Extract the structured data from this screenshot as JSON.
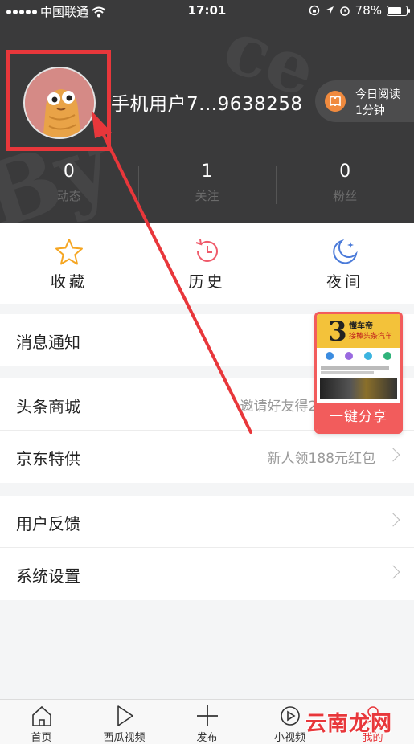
{
  "status_bar": {
    "carrier": "中国联通",
    "time": "17:01",
    "battery": "78%",
    "battery_level": 0.78
  },
  "profile": {
    "username": "手机用户7...9638258",
    "read_badge": {
      "line1": "今日阅读",
      "line2": "1分钟"
    },
    "stats": [
      {
        "value": "0",
        "label": "动态"
      },
      {
        "value": "1",
        "label": "关注"
      },
      {
        "value": "0",
        "label": "粉丝"
      }
    ]
  },
  "quick_actions": [
    {
      "label": "收藏",
      "icon": "star-icon",
      "color": "#f5a623"
    },
    {
      "label": "历史",
      "icon": "history-clock-icon",
      "color": "#ef5a6a"
    },
    {
      "label": "夜间",
      "icon": "moon-icon",
      "color": "#4a7ad9"
    }
  ],
  "menu": {
    "notifications": {
      "label": "消息通知"
    },
    "mall": {
      "label": "头条商城",
      "hint": "邀请好友得200元现金"
    },
    "jd": {
      "label": "京东特供",
      "hint": "新人领188元红包"
    },
    "feedback": {
      "label": "用户反馈"
    },
    "settings": {
      "label": "系统设置"
    }
  },
  "share_card": {
    "title": "懂车帝",
    "subtitle": "接棒头条汽车",
    "button": "一键分享"
  },
  "tabbar": [
    {
      "label": "首页",
      "icon": "home-icon"
    },
    {
      "label": "西瓜视频",
      "icon": "play-icon"
    },
    {
      "label": "发布",
      "icon": "plus-icon"
    },
    {
      "label": "小视频",
      "icon": "small-video-icon"
    },
    {
      "label": "我的",
      "icon": "user-icon",
      "active": true
    }
  ],
  "watermark": "云南龙网",
  "colors": {
    "accent_red": "#e8373b",
    "header_bg": "#3a3a3b",
    "share_red": "#f25c5c"
  }
}
